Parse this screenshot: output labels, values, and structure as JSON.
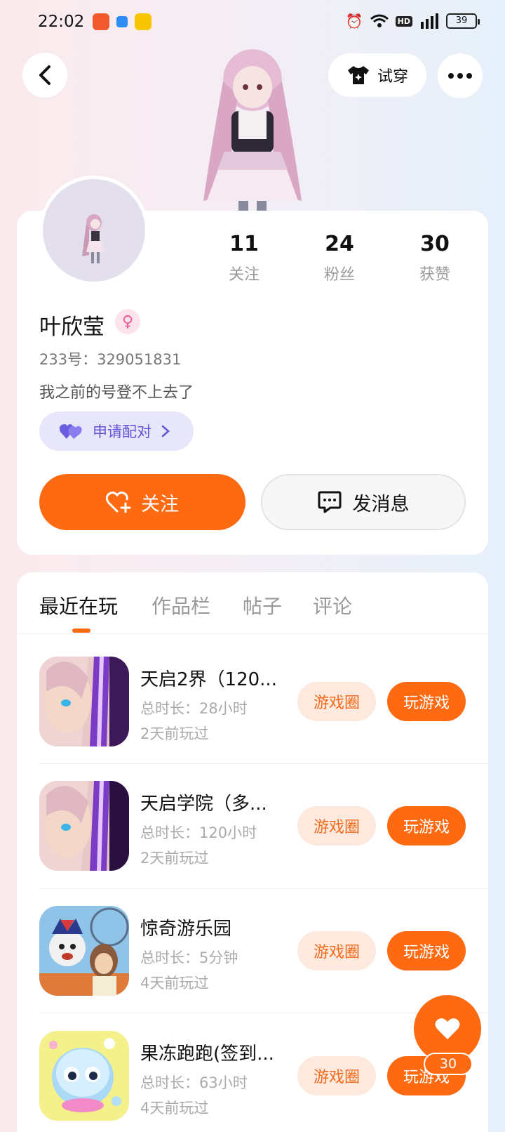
{
  "status_bar": {
    "time": "22:02",
    "battery": "39"
  },
  "header": {
    "try_on_label": "试穿"
  },
  "profile": {
    "stats": [
      {
        "value": "11",
        "label": "关注"
      },
      {
        "value": "24",
        "label": "粉丝"
      },
      {
        "value": "30",
        "label": "获赞"
      }
    ],
    "username": "叶欣莹",
    "user_id": "233号：329051831",
    "bio": "我之前的号登不上去了",
    "match_label": "申请配对",
    "follow_label": "关注",
    "message_label": "发消息"
  },
  "tabs": [
    "最近在玩",
    "作品栏",
    "帖子",
    "评论"
  ],
  "games": [
    {
      "title": "天启2界（120...",
      "duration": "总时长：28小时",
      "last_played": "2天前玩过",
      "circle_label": "游戏圈",
      "play_label": "玩游戏"
    },
    {
      "title": "天启学院（多...",
      "duration": "总时长：120小时",
      "last_played": "2天前玩过",
      "circle_label": "游戏圈",
      "play_label": "玩游戏"
    },
    {
      "title": "惊奇游乐园",
      "duration": "总时长：5分钟",
      "last_played": "4天前玩过",
      "circle_label": "游戏圈",
      "play_label": "玩游戏"
    },
    {
      "title": "果冻跑跑(签到...",
      "duration": "总时长：63小时",
      "last_played": "4天前玩过",
      "circle_label": "游戏圈",
      "play_label": "玩游戏"
    }
  ],
  "like_fab": {
    "count": "30"
  },
  "colors": {
    "accent": "#fd6a12",
    "match": "#5f55d6"
  }
}
